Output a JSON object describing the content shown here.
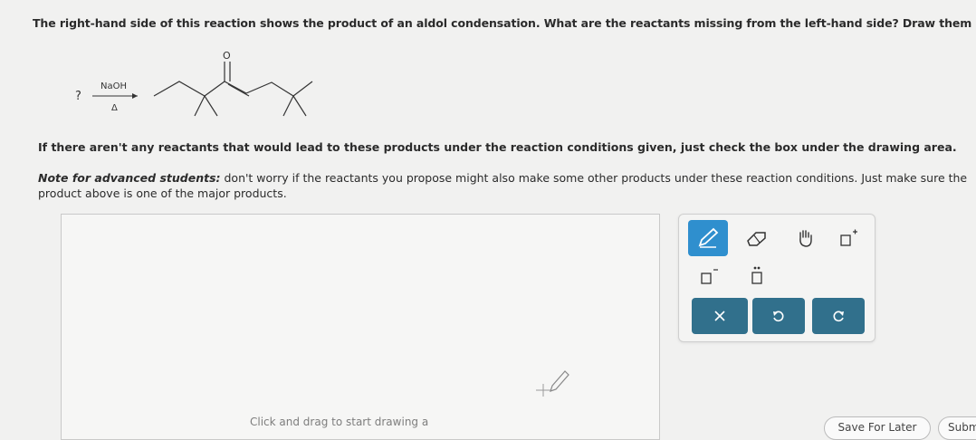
{
  "question": "The right-hand side of this reaction shows the product of an aldol condensation. What are the reactants missing from the left-hand side? Draw them below.",
  "reaction": {
    "missing_symbol": "?",
    "reagent_top": "NaOH",
    "reagent_bottom": "Δ",
    "carbonyl_atom": "O"
  },
  "instructions": "If there aren't any reactants that would lead to these products under the reaction conditions given, just check the box under the drawing area.",
  "note": {
    "lead": "Note for advanced students:",
    "text_line1": " don't worry if the reactants you propose might also make some other products under these reaction conditions. Just make sure the",
    "text_line2": "product above is one of the major products."
  },
  "canvas": {
    "hint": "Click and drag to start drawing a"
  },
  "toolbar": {
    "tools": [
      "pencil-icon",
      "eraser-icon",
      "hand-icon",
      "add-charge-icon",
      "remove-charge-icon",
      "lone-pair-icon"
    ],
    "actions": [
      "clear-icon",
      "undo-icon",
      "redo-icon"
    ],
    "accent": "#2f8fce",
    "action_color": "#31708c"
  },
  "footer": {
    "save_label": "Save For Later",
    "submit_label": "Subm"
  }
}
